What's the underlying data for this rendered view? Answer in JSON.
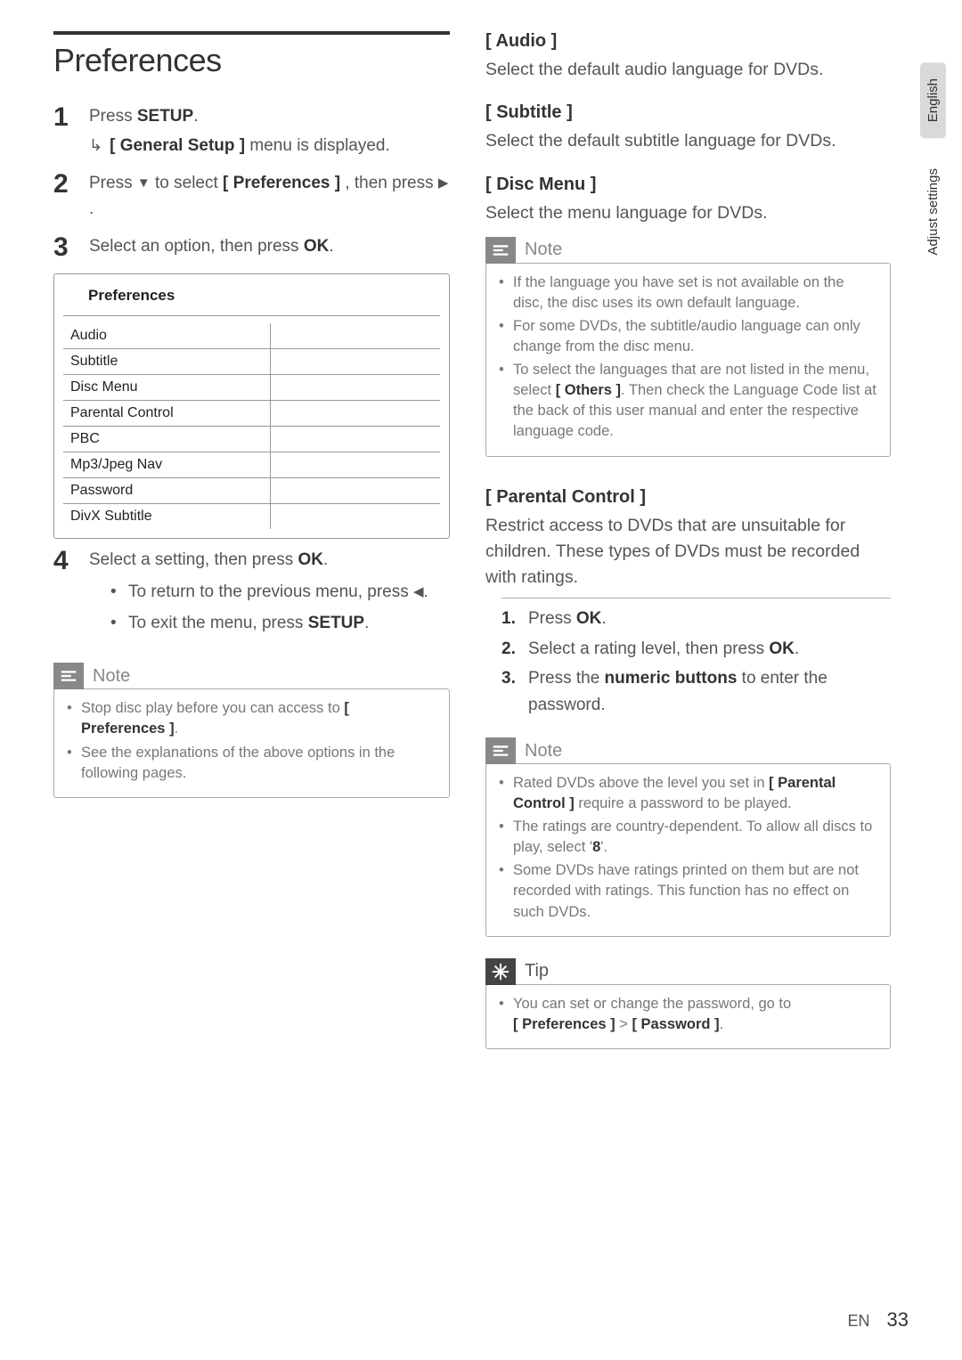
{
  "sideTabs": {
    "lang": "English",
    "section": "Adjust settings"
  },
  "left": {
    "title": "Preferences",
    "steps": {
      "s1": {
        "a": "Press ",
        "b": "SETUP",
        "c": ".",
        "sub_a": "[ General Setup ]",
        "sub_b": " menu is displayed."
      },
      "s2": {
        "a": "Press ",
        "b": " to select ",
        "c": "[ Preferences ]",
        "d": " , then press ",
        "e": "."
      },
      "s3": {
        "a": "Select an option, then press ",
        "b": "OK",
        "c": "."
      },
      "s4": {
        "a": "Select a setting, then press ",
        "b": "OK",
        "c": ".",
        "bullets": {
          "b1a": "To return to the previous menu, press ",
          "b1b": ".",
          "b2a": "To exit the menu, press ",
          "b2b": "SETUP",
          "b2c": "."
        }
      }
    },
    "menu": {
      "header": "Preferences",
      "items": [
        "Audio",
        "Subtitle",
        "Disc Menu",
        "Parental Control",
        "PBC",
        "Mp3/Jpeg Nav",
        "Password",
        "DivX Subtitle"
      ]
    },
    "note": {
      "label": "Note",
      "items": {
        "n1a": "Stop disc play before you can access to ",
        "n1b": "[ Preferences ]",
        "n1c": ".",
        "n2": "See the explanations of the above options in the following pages."
      }
    }
  },
  "right": {
    "audio": {
      "title": "[ Audio ]",
      "desc": "Select the default audio language for DVDs."
    },
    "subtitle": {
      "title": "[ Subtitle ]",
      "desc": "Select the default subtitle language for DVDs."
    },
    "discmenu": {
      "title": "[ Disc Menu ]",
      "desc": "Select the menu language for DVDs."
    },
    "note1": {
      "label": "Note",
      "n1": "If the language you have set is not available on the disc, the disc uses its own default language.",
      "n2": "For some DVDs, the subtitle/audio language can only change from the disc menu.",
      "n3a": "To select the languages that are not listed in the menu, select ",
      "n3b": "[ Others ]",
      "n3c": ". Then check the Language Code list at the back of this user manual and enter the respective language code."
    },
    "parental": {
      "title": "[ Parental Control ]",
      "desc": "Restrict access to DVDs that are unsuitable for children. These types of DVDs must be recorded with ratings.",
      "li1a": "Press ",
      "li1b": "OK",
      "li1c": ".",
      "li2a": "Select a rating level, then press ",
      "li2b": "OK",
      "li2c": ".",
      "li3a": "Press the ",
      "li3b": "numeric buttons",
      "li3c": " to enter the password."
    },
    "note2": {
      "label": "Note",
      "n1a": "Rated DVDs above the level you set in ",
      "n1b": "[ Parental Control ]",
      "n1c": " require a password to be played.",
      "n2a": "The ratings are country-dependent. To allow all discs to play, select '",
      "n2b": "8",
      "n2c": "'.",
      "n3": "Some DVDs have ratings printed on them but are not recorded with ratings.  This function has no effect on such DVDs."
    },
    "tip": {
      "label": "Tip",
      "t1a": "You can set or change the password, go to ",
      "t1b": "[ Preferences ]",
      "t1c": " > ",
      "t1d": "[ Password ]",
      "t1e": "."
    }
  },
  "footer": {
    "lang": "EN",
    "page": "33"
  }
}
